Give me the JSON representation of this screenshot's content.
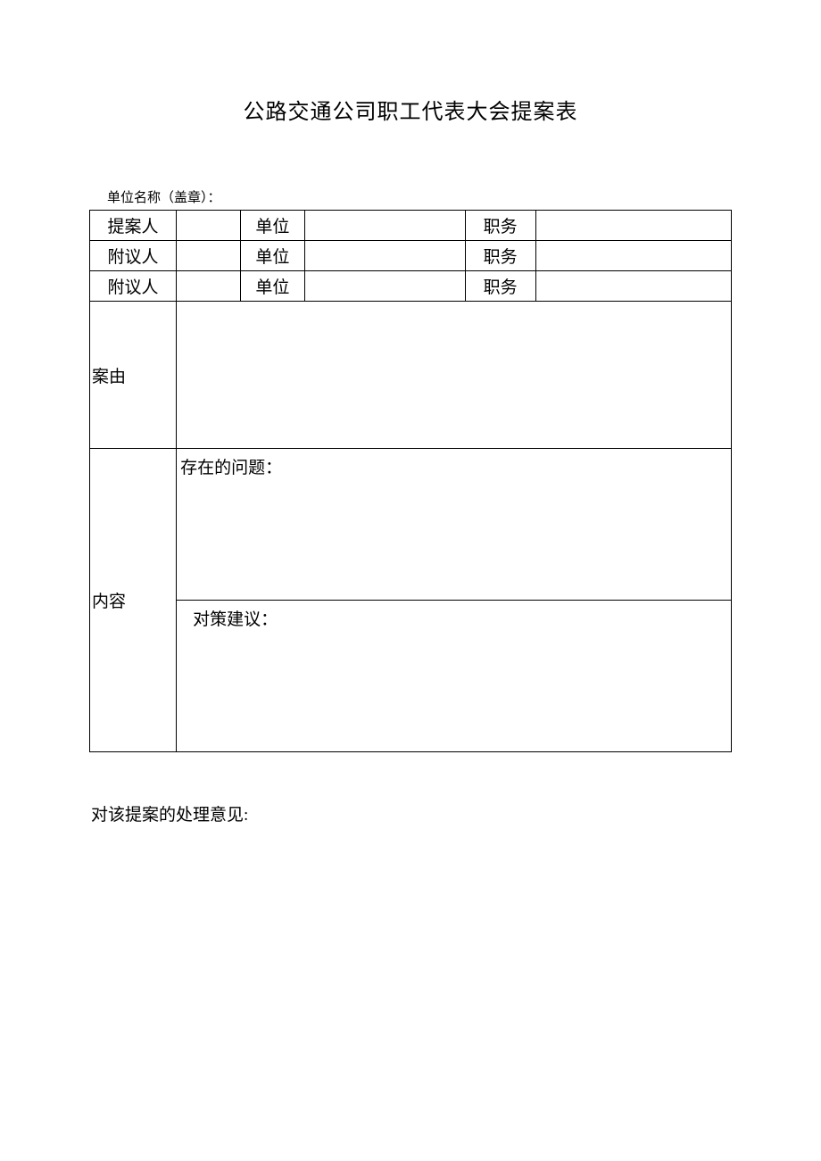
{
  "title": "公路交通公司职工代表大会提案表",
  "unit_label": "单位名称（盖章）：",
  "rows": {
    "r1": {
      "label1": "提案人",
      "val1": "",
      "label2": "单位",
      "val2": "",
      "label3": "职务",
      "val3": ""
    },
    "r2": {
      "label1": "附议人",
      "val1": "",
      "label2": "单位",
      "val2": "",
      "label3": "职务",
      "val3": ""
    },
    "r3": {
      "label1": "附议人",
      "val1": "",
      "label2": "单位",
      "val2": "",
      "label3": "职务",
      "val3": ""
    }
  },
  "anyou": {
    "label": "案由",
    "content": ""
  },
  "neirong": {
    "label": "内容",
    "problem_label": "存在的问题：",
    "suggestion_label": "对策建议："
  },
  "opinion_label": "对该提案的处理意见:"
}
